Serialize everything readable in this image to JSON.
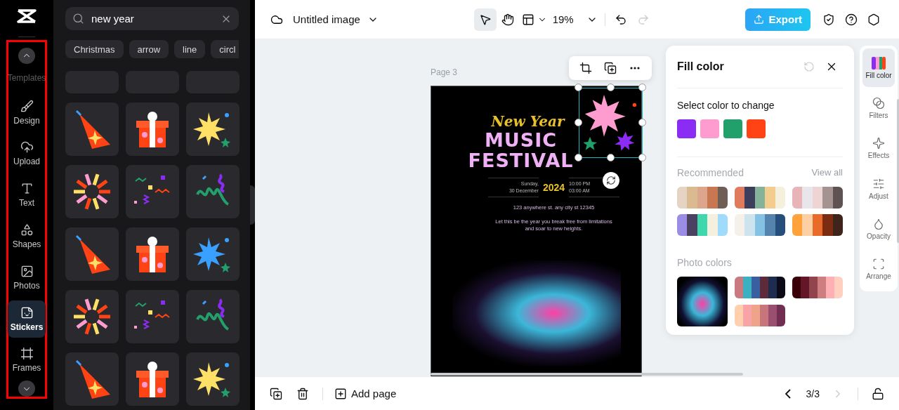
{
  "nav": {
    "items": [
      {
        "label": "Templates",
        "selected": false
      },
      {
        "label": "Design",
        "selected": false
      },
      {
        "label": "Upload",
        "selected": false
      },
      {
        "label": "Text",
        "selected": false
      },
      {
        "label": "Shapes",
        "selected": false
      },
      {
        "label": "Photos",
        "selected": false
      },
      {
        "label": "Stickers",
        "selected": true
      },
      {
        "label": "Frames",
        "selected": false
      }
    ]
  },
  "sticker_panel": {
    "search": {
      "value": "new year"
    },
    "chips": [
      "Christmas",
      "arrow",
      "line",
      "circl"
    ]
  },
  "top_bar": {
    "title": "Untitled image",
    "zoom": "19%",
    "export": "Export"
  },
  "canvas": {
    "page_label": "Page 3",
    "poster": {
      "script_title": "New Year",
      "title_lines": [
        "MUSIC",
        "FESTIVAL"
      ],
      "date_lines": [
        "Sunday,",
        "30 December"
      ],
      "year": "2024",
      "time_lines": [
        "10:00 PM",
        "03:00 AM"
      ],
      "address": "123 anywhere st. any city st 12345",
      "tagline": "Let this be the year you break free from limitations and soar to new heights."
    }
  },
  "fill_panel": {
    "title": "Fill color",
    "subtitle": "Select color to change",
    "swatches": [
      {
        "color": "#8b2cf5"
      },
      {
        "color": "#ff9ccf"
      },
      {
        "color": "#22a06b"
      },
      {
        "color": "#ff4314"
      }
    ],
    "recommended": {
      "heading": "Recommended",
      "view_all": "View all",
      "palettes": [
        {
          "segments": [
            {
              "color": "#e5d3c3"
            },
            {
              "color": "#dbb991"
            },
            {
              "color": "#dba68c"
            },
            {
              "color": "#c87750"
            },
            {
              "color": "#6f5e55"
            }
          ]
        },
        {
          "segments": [
            {
              "color": "#e07b5d"
            },
            {
              "color": "#3d3d5c"
            },
            {
              "color": "#84b39a"
            },
            {
              "color": "#f3cd8e"
            },
            {
              "color": "#f5f0dc"
            }
          ]
        },
        {
          "segments": [
            {
              "color": "#e8b4b8"
            },
            {
              "color": "#e8e6ea"
            },
            {
              "color": "#eed5d3"
            },
            {
              "color": "#a59391"
            },
            {
              "color": "#5e5254"
            }
          ]
        },
        {
          "segments": [
            {
              "color": "#9b8de6"
            },
            {
              "color": "#4a4260"
            },
            {
              "color": "#3fd8ae"
            },
            {
              "color": "#f5f0de"
            },
            {
              "color": "#9fdcfc"
            }
          ]
        },
        {
          "segments": [
            {
              "color": "#f5f1ea"
            },
            {
              "color": "#cde3ee"
            },
            {
              "color": "#84c2e4"
            },
            {
              "color": "#5484ad"
            },
            {
              "color": "#264e7a"
            }
          ]
        },
        {
          "segments": [
            {
              "color": "#ffa23c"
            },
            {
              "color": "#fdd0a4"
            },
            {
              "color": "#ea6a2a"
            },
            {
              "color": "#7c2c10"
            },
            {
              "color": "#3e241a"
            }
          ]
        }
      ]
    },
    "photo_colors": {
      "heading": "Photo colors",
      "palettes": [
        {
          "segments": [
            {
              "color": "#c97a80"
            },
            {
              "color": "#3ab0c0"
            },
            {
              "color": "#3a5fa0"
            },
            {
              "color": "#5c2a3a"
            },
            {
              "color": "#1e2c50"
            },
            {
              "color": "#0d0a18"
            }
          ]
        },
        {
          "segments": [
            {
              "color": "#3a0008"
            },
            {
              "color": "#621628"
            },
            {
              "color": "#92444c"
            },
            {
              "color": "#cf7e80"
            },
            {
              "color": "#ffb0b4"
            },
            {
              "color": "#ffcfc0"
            }
          ]
        },
        {
          "segments": [
            {
              "color": "#ffcfae"
            },
            {
              "color": "#f9a3a6"
            },
            {
              "color": "#efa489"
            },
            {
              "color": "#c8767b"
            },
            {
              "color": "#9a4f70"
            },
            {
              "color": "#722e50"
            }
          ]
        }
      ]
    }
  },
  "right_rail": {
    "items": [
      {
        "label": "Fill color",
        "selected": true
      },
      {
        "label": "Filters",
        "selected": false
      },
      {
        "label": "Effects",
        "selected": false
      },
      {
        "label": "Adjust",
        "selected": false
      },
      {
        "label": "Opacity",
        "selected": false
      },
      {
        "label": "Arrange",
        "selected": false
      }
    ]
  },
  "bottom_bar": {
    "add_page": "Add page",
    "pager": "3/3"
  }
}
